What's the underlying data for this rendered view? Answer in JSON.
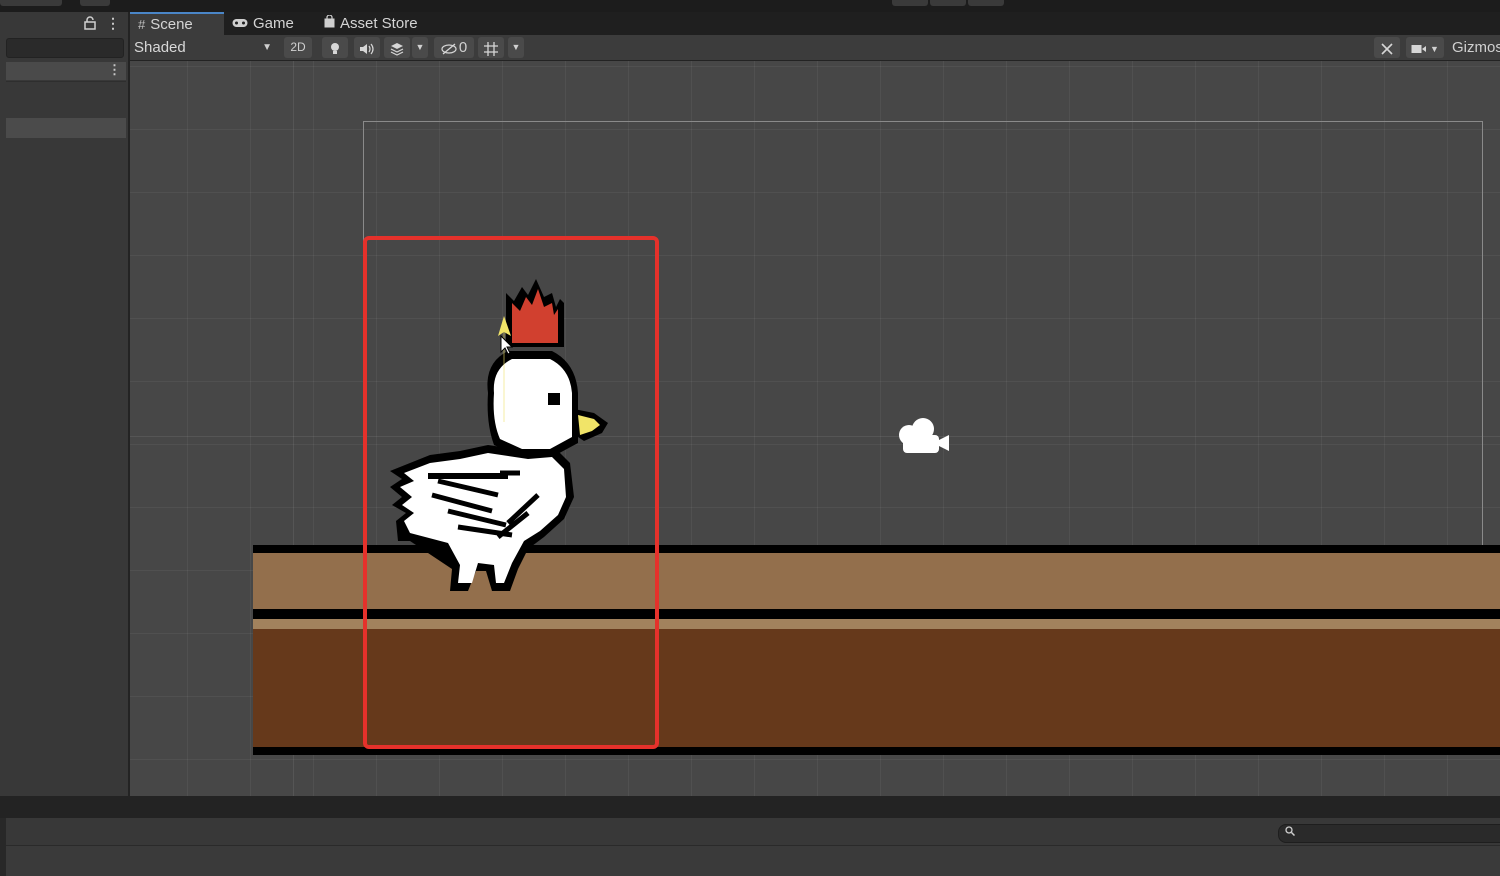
{
  "tabs": {
    "scene": "Scene",
    "game": "Game",
    "asset_store": "Asset Store"
  },
  "toolbar": {
    "shading_mode": "Shaded",
    "mode_2d": "2D",
    "hidden_count": "0",
    "gizmos": "Gizmos"
  },
  "icons": {
    "scene_tab": "grid-icon",
    "game_tab": "gamepad-icon",
    "asset_store_tab": "shopping-bag-icon",
    "lighting": "light-bulb-icon",
    "audio": "speaker-icon",
    "effects": "layers-icon",
    "visibility": "eye-slash-icon",
    "grid_snap": "grid-snap-icon",
    "tools": "tools-icon",
    "camera": "video-camera-icon",
    "lock": "lock-icon"
  },
  "colors": {
    "selection": "#e5312b",
    "ground_light": "#936f4c",
    "ground_dark": "#66391b",
    "crown": "#d1402f",
    "beak": "#f1e468",
    "scene_background": "#474747"
  }
}
